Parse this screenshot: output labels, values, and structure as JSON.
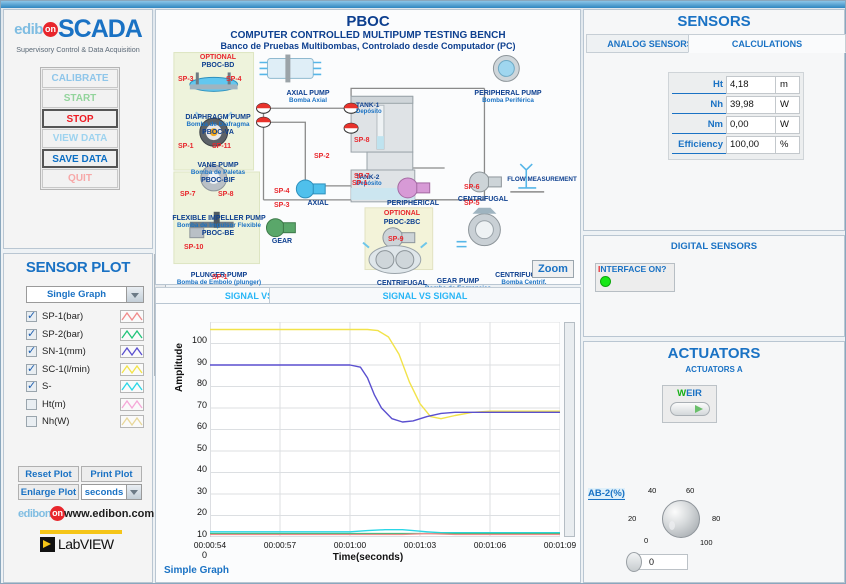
{
  "brand": {
    "edibon": "edib",
    "edibon_dot": "on",
    "scada": "SCADA",
    "subtitle": "Supervisory Control & Data Acquisition",
    "url_prefix": "edibon",
    "url": "www.edibon.com",
    "labview": "LabVIEW"
  },
  "main_buttons": [
    {
      "label": "CALIBRATE",
      "state": "disabled"
    },
    {
      "label": "START",
      "state": "disabled"
    },
    {
      "label": "STOP",
      "state": "active"
    },
    {
      "label": "VIEW DATA",
      "state": "disabled"
    },
    {
      "label": "SAVE DATA",
      "state": "active"
    },
    {
      "label": "QUIT",
      "state": "disabled"
    }
  ],
  "sensor_plot": {
    "title": "SENSOR PLOT",
    "graph_mode": "Single Graph",
    "signals": [
      {
        "label": "SP-1(bar)",
        "checked": true,
        "color": "#f08a8a"
      },
      {
        "label": "SP-2(bar)",
        "checked": true,
        "color": "#22c47a"
      },
      {
        "label": "SN-1(mm)",
        "checked": true,
        "color": "#5a4fcf"
      },
      {
        "label": "SC-1(l/min)",
        "checked": true,
        "color": "#f2e34a"
      },
      {
        "label": "S-",
        "checked": true,
        "color": "#2ad6e6"
      },
      {
        "label": "Ht(m)",
        "checked": false,
        "color": "#f5a8d8"
      },
      {
        "label": "Nh(W)",
        "checked": false,
        "color": "#e8d79a"
      }
    ],
    "buttons": {
      "reset": "Reset Plot",
      "print": "Print Plot",
      "enlarge": "Enlarge Plot"
    },
    "time_unit": "seconds"
  },
  "diagram": {
    "title": "PBOC",
    "subtitle_en": "COMPUTER CONTROLLED MULTIPUMP TESTING BENCH",
    "subtitle_es": "Banco de Pruebas Multibombas, Controlado desde Computador (PC)",
    "zoom_label": "Zoom",
    "optional_label": "OPTIONAL",
    "modules": [
      {
        "code": "PBOC-BD",
        "name_en": "DIAPHRAGM PUMP",
        "name_es": "Bomba de Diafragma",
        "optional": true
      },
      {
        "code": "PBOC-VA",
        "name_en": "VANE PUMP",
        "name_es": "Bomba de Paletas",
        "optional": false
      },
      {
        "code": "PBOC-BIF",
        "name_en": "FLEXIBLE IMPELLER PUMP",
        "name_es": "Bomba de Impulsor Flexible",
        "optional": false
      },
      {
        "code": "PBOC-BE",
        "name_en": "PLUNGER PUMP",
        "name_es": "Bomba de Embolo (plunger)",
        "optional": false
      },
      {
        "code": "PBOC-2BC",
        "name_en": "CENTRIFUGAL",
        "name_es": "",
        "optional": true
      }
    ],
    "pumps": [
      {
        "name_en": "AXIAL PUMP",
        "name_es": "Bomba Axial"
      },
      {
        "name_en": "PERIPHERAL PUMP",
        "name_es": "Bomba Periférica"
      },
      {
        "name_en": "GEAR PUMP",
        "name_es": "Bomba de Engranajes"
      },
      {
        "name_en": "CENTRIFUGAL P.",
        "name_es": "Bomba Centrif."
      }
    ],
    "tanks": [
      {
        "id": "TANK-1",
        "es": "Depósito"
      },
      {
        "id": "TANK-2",
        "es": "Depósito"
      }
    ],
    "inline_labels": [
      "AXIAL",
      "GEAR",
      "PERIPHERICAL",
      "CENTRIFUGAL",
      "CENTRIFUGAL"
    ],
    "flow_measurement": "FLOW MEASUREMENT",
    "sp_tags": [
      "SP-3",
      "SP-4",
      "SP-1",
      "SP-11",
      "SP-7",
      "SP-8",
      "SP-10",
      "SP-1",
      "SP-2",
      "SP-1",
      "SP-4",
      "SP-3",
      "SP-8",
      "SP-7",
      "SP-6",
      "SP-5",
      "SP-9"
    ]
  },
  "plot_tabs": [
    {
      "label": "SIGNAL VS TIME",
      "active": true
    },
    {
      "label": "SIGNAL VS SIGNAL",
      "active": false
    }
  ],
  "chart_data": {
    "type": "line",
    "title": "",
    "xlabel": "Time(seconds)",
    "ylabel": "Amplitude",
    "footer": "Simple Graph",
    "ylim": [
      0,
      100
    ],
    "yticks": [
      0,
      10,
      20,
      30,
      40,
      50,
      60,
      70,
      80,
      90,
      100
    ],
    "xticks": [
      "00:00:54",
      "00:00:57",
      "00:01:00",
      "00:01:03",
      "00:01:06",
      "00:01:09"
    ],
    "xlim": [
      0,
      100
    ],
    "grid": true,
    "legend": "left-panel",
    "series": [
      {
        "name": "SC-1(l/min)",
        "color": "#f2e34a",
        "x": [
          0,
          5,
          10,
          15,
          20,
          25,
          30,
          35,
          40,
          45,
          48,
          51,
          54,
          57,
          60,
          63,
          66,
          70,
          75,
          80,
          85,
          90,
          95,
          100
        ],
        "y": [
          96.5,
          96.5,
          96.5,
          96.5,
          96.5,
          96.5,
          96.5,
          96.5,
          96.5,
          96.5,
          96,
          93,
          85,
          72,
          62,
          56,
          55,
          56.5,
          58,
          58.5,
          58.5,
          58.5,
          58.5,
          58.5
        ]
      },
      {
        "name": "SN-1(mm)",
        "color": "#5a4fcf",
        "x": [
          0,
          5,
          10,
          15,
          20,
          25,
          30,
          35,
          40,
          43,
          45,
          47,
          49,
          52,
          55,
          58,
          62,
          66,
          70,
          75,
          80,
          85,
          90,
          95,
          100
        ],
        "y": [
          80,
          80,
          80,
          80,
          80,
          80,
          80,
          80,
          80,
          79,
          74,
          66,
          60,
          55,
          53.5,
          54,
          56,
          57.5,
          58,
          58,
          58,
          58,
          58,
          58,
          58
        ]
      },
      {
        "name": "S-",
        "color": "#2ad6e6",
        "x": [
          0,
          10,
          20,
          30,
          40,
          45,
          50,
          55,
          58,
          62,
          66,
          70,
          80,
          90,
          100
        ],
        "y": [
          2.4,
          2.4,
          2.4,
          2.4,
          2.4,
          3.0,
          3.4,
          3.4,
          3.0,
          2.4,
          2.0,
          2.0,
          2.0,
          2.0,
          2.0
        ]
      },
      {
        "name": "SP-2(bar)",
        "color": "#22c47a",
        "x": [
          0,
          20,
          40,
          60,
          80,
          100
        ],
        "y": [
          1.6,
          1.6,
          1.6,
          1.6,
          1.6,
          1.6
        ]
      },
      {
        "name": "SP-1(bar)",
        "color": "#f08a8a",
        "x": [
          0,
          20,
          40,
          55,
          62,
          70,
          100
        ],
        "y": [
          1.2,
          1.2,
          1.2,
          1.2,
          1.6,
          1.2,
          1.2
        ]
      }
    ]
  },
  "sensors": {
    "title": "SENSORS",
    "tabs": [
      {
        "label": "ANALOG SENSORS",
        "active": false
      },
      {
        "label": "CALCULATIONS",
        "active": true
      }
    ],
    "calculations": [
      {
        "label": "Ht",
        "value": "4,18",
        "unit": "m"
      },
      {
        "label": "Nh",
        "value": "39,98",
        "unit": "W"
      },
      {
        "label": "Nm",
        "value": "0,00",
        "unit": "W"
      },
      {
        "label": "Efficiency",
        "value": "100,00",
        "unit": "%"
      }
    ]
  },
  "digital_sensors": {
    "title": "DIGITAL SENSORS",
    "interface_label_red": "I",
    "interface_label_rest": "NTERFACE ON?",
    "led_on": true,
    "led_color": "#18e818"
  },
  "actuators": {
    "title": "ACTUATORS",
    "subtitle": "ACTUATORS A",
    "weir": {
      "label_g": "W",
      "label_b": "EIR",
      "state": "on"
    },
    "ab2": {
      "label": "AB-2(%)",
      "value": "0",
      "ticks": [
        "0",
        "20",
        "40",
        "60",
        "80",
        "100"
      ]
    }
  }
}
